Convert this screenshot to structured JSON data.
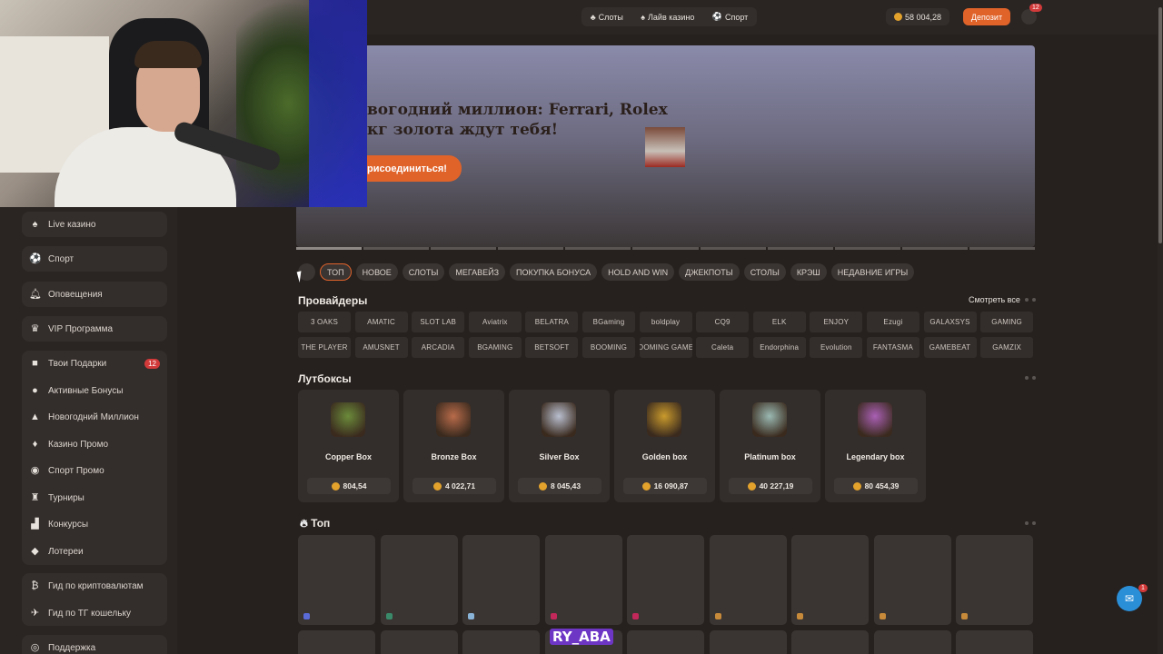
{
  "header": {
    "nav": [
      {
        "label": "Слоты",
        "icon": "slots-icon"
      },
      {
        "label": "Лайв казино",
        "icon": "live-icon"
      },
      {
        "label": "Спорт",
        "icon": "sport-icon"
      }
    ],
    "balance": "58 004,28",
    "deposit_label": "Депозит",
    "notifications_count": "12"
  },
  "sidebar": {
    "single": [
      {
        "label": "Live казино",
        "icon": "live-icon"
      },
      {
        "label": "Спорт",
        "icon": "sport-icon"
      },
      {
        "label": "Оповещения",
        "icon": "bell-icon"
      },
      {
        "label": "VIP Программа",
        "icon": "crown-icon"
      }
    ],
    "group1": [
      {
        "label": "Твои Подарки",
        "icon": "gift-icon",
        "badge": "12"
      },
      {
        "label": "Активные Бонусы",
        "icon": "bonus-icon"
      },
      {
        "label": "Новогодний Миллион",
        "icon": "tree-icon"
      },
      {
        "label": "Казино Промо",
        "icon": "casino-icon"
      },
      {
        "label": "Спорт Промо",
        "icon": "ball-icon"
      },
      {
        "label": "Турниры",
        "icon": "trophy-icon"
      },
      {
        "label": "Конкурсы",
        "icon": "chart-icon"
      },
      {
        "label": "Лотереи",
        "icon": "ticket-icon"
      }
    ],
    "group2": [
      {
        "label": "Гид по криптовалютам",
        "icon": "crypto-icon"
      },
      {
        "label": "Гид по ТГ кошельку",
        "icon": "wallet-icon"
      }
    ],
    "support": {
      "label": "Поддержка",
      "icon": "support-icon"
    }
  },
  "banner": {
    "title_line1": "вогодний миллион: Ferrari, Rolex",
    "title_line2": "кг золота ждут тебя!",
    "button": "рисоединиться!"
  },
  "tabs": [
    "ТОП",
    "НОВОЕ",
    "СЛОТЫ",
    "МЕГАВЕЙЗ",
    "ПОКУПКА БОНУСА",
    "HOLD AND WIN",
    "ДЖЕКПОТЫ",
    "СТОЛЫ",
    "КРЭШ",
    "НЕДАВНИЕ ИГРЫ"
  ],
  "providers_title": "Провайдеры",
  "see_all": "Смотреть все",
  "providers": [
    "3 OAKS",
    "AMATIC",
    "SLOT LAB",
    "Aviatrix",
    "BELATRA",
    "BGaming",
    "boldplay",
    "CQ9",
    "ELK",
    "ENJOY",
    "Ezugi",
    "GALAXSYS",
    "GAMING",
    "THE PLAYER",
    "AMUSNET",
    "ARCADIA",
    "BGAMING",
    "BETSOFT",
    "BOOMING",
    "BOOMING GAMES",
    "Caleta",
    "Endorphina",
    "Evolution",
    "FANTASMA",
    "GAMEBEAT",
    "GAMZIX"
  ],
  "lootboxes_title": "Лутбоксы",
  "lootboxes": [
    {
      "name": "Copper Box",
      "price": "804,54",
      "color": "#6b8b3a"
    },
    {
      "name": "Bronze Box",
      "price": "4 022,71",
      "color": "#b86b4a"
    },
    {
      "name": "Silver Box",
      "price": "8 045,43",
      "color": "#b9bfcf"
    },
    {
      "name": "Golden box",
      "price": "16 090,87",
      "color": "#c99a2c"
    },
    {
      "name": "Platinum box",
      "price": "40 227,19",
      "color": "#9ab9b2"
    },
    {
      "name": "Legendary box",
      "price": "80 454,39",
      "color": "#a95fb4"
    }
  ],
  "top_title": "Топ",
  "overlay_text": "RY_ABA",
  "chat_badge": "1"
}
